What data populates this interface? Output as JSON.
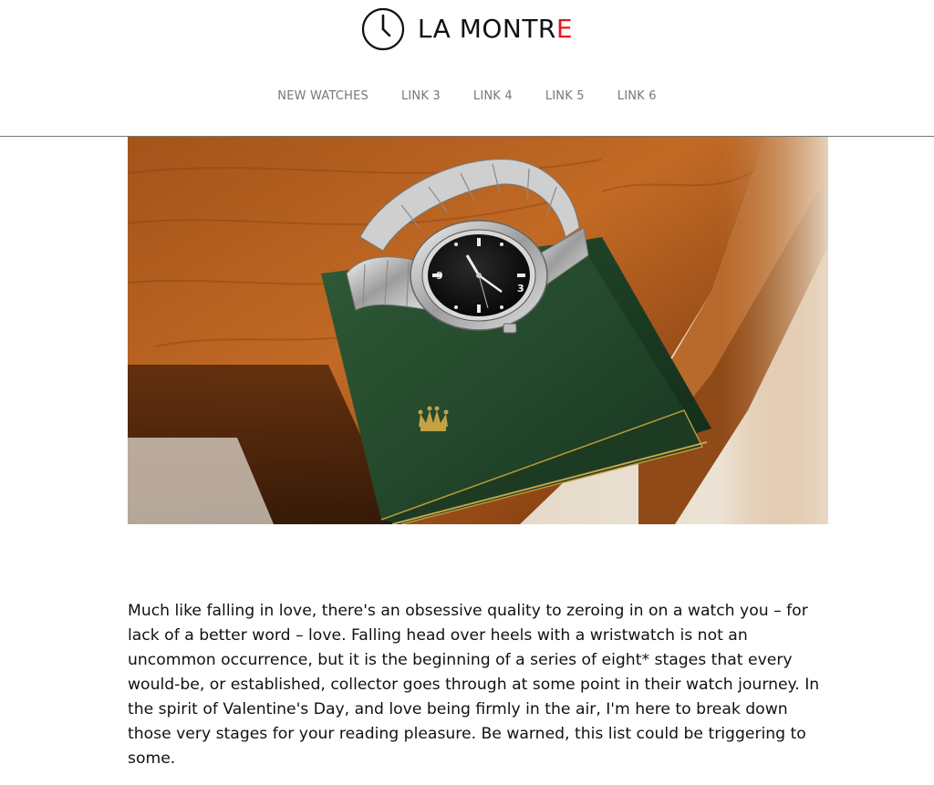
{
  "site": {
    "logo_icon": "clock-icon",
    "name_main": "LA MONTR",
    "name_accent": "E",
    "accent_color": "#e8141c"
  },
  "nav": {
    "items": [
      {
        "label": "NEW WATCHES"
      },
      {
        "label": "LINK 3"
      },
      {
        "label": "LINK 4"
      },
      {
        "label": "LINK 5"
      },
      {
        "label": "LINK 6"
      }
    ]
  },
  "hero": {
    "image": "watch-on-green-box-photo"
  },
  "article": {
    "intro": "Much like falling in love, there's an obsessive quality to zeroing in on a watch you – for lack of a better word – love. Falling head over heels with a wristwatch is not an uncommon occurrence, but it is the beginning of a series of eight* stages that every would-be, or established, collector goes through at some point in their watch journey. In the spirit of Valentine's Day, and love being firmly in the air, I'm here to break down those very stages for your reading pleasure. Be warned, this list could be triggering to some."
  }
}
